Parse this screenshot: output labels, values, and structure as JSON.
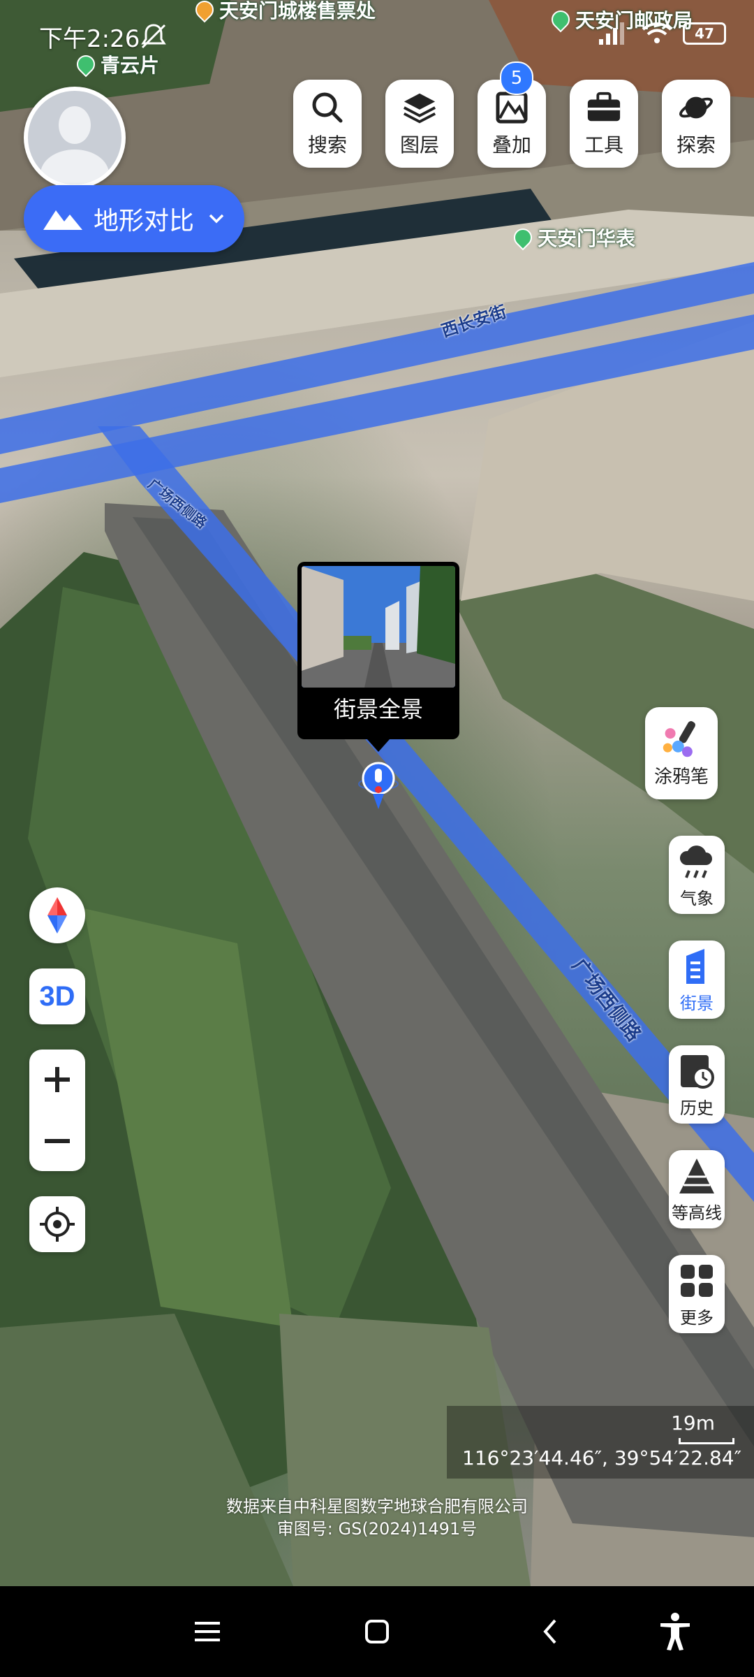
{
  "status_bar": {
    "time": "下午2:26",
    "battery": "47"
  },
  "map_labels": {
    "poi_top": "天安门城楼售票处",
    "poi_qingyunpian": "青云片",
    "poi_post_office": "天安门邮政局",
    "poi_huabiao": "天安门华表",
    "road_xichangan": "西长安街",
    "road_guangchang_top": "广场西侧路",
    "road_guangchang": "广场西侧路"
  },
  "mode_selector": {
    "label": "地形对比"
  },
  "top_toolbar": {
    "search": "搜索",
    "layers": "图层",
    "overlay": "叠加",
    "overlay_badge": "5",
    "tools": "工具",
    "explore": "探索"
  },
  "street_view_popup": {
    "label": "街景全景"
  },
  "right_tools": {
    "graffiti": "涂鸦笔",
    "weather": "气象",
    "streetview": "街景",
    "history": "历史",
    "contour": "等高线",
    "more": "更多"
  },
  "left_controls": {
    "three_d": "3D"
  },
  "scale": {
    "label": "19m"
  },
  "coordinates": "116°23′44.46″, 39°54′22.84″",
  "attribution": {
    "line1": "数据来自中科星图数字地球合肥有限公司",
    "line2": "审图号: GS(2024)1491号"
  },
  "colors": {
    "accent": "#3b6cf6",
    "road_highlight": "#3d6fe8",
    "poi_green": "#3fbf6f"
  }
}
